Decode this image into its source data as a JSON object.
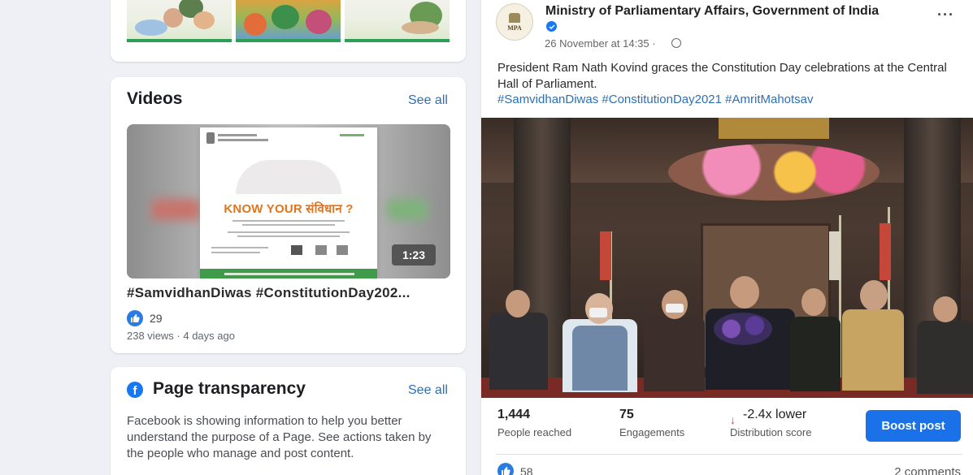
{
  "photos_card": {
    "thumbnails": [
      "photo-1",
      "photo-2",
      "photo-3"
    ]
  },
  "videos": {
    "title": "Videos",
    "see_all": "See all",
    "video": {
      "poster_headline": "KNOW YOUR संविधान ?",
      "duration": "1:23",
      "title": "#SamvidhanDiwas #ConstitutionDay202...",
      "like_count": "29",
      "meta": "238 views · 4 days ago"
    }
  },
  "transparency": {
    "title": "Page transparency",
    "see_all": "See all",
    "text": "Facebook is showing information to help you better understand the purpose of a Page. See actions taken by the people who manage and post content."
  },
  "post": {
    "avatar_text": "MPA",
    "page_name": "Ministry of Parliamentary Affairs, Government of India",
    "time": "26 November at 14:35 ·",
    "more": "···",
    "text": "President Ram Nath Kovind graces the Constitution Day celebrations at the Central Hall of Parliament.",
    "hashtags": "#SamvidhanDiwas #ConstitutionDay2021 #AmritMahotsav",
    "stats": {
      "reached_value": "1,444",
      "reached_label": "People reached",
      "engagements_value": "75",
      "engagements_label": "Engagements",
      "distribution_arrow": "↓",
      "distribution_value": "-2.4x lower",
      "distribution_label": "Distribution score"
    },
    "boost_button": "Boost post",
    "like_count": "58",
    "comments": "2 comments"
  },
  "colors": {
    "accent_blue": "#1b72e8",
    "link_blue": "#2d6fb6",
    "negative_red": "#e53935",
    "background": "#eef0f5"
  },
  "icons": [
    "like-icon",
    "facebook-icon",
    "verified-icon",
    "globe-icon",
    "more-options-icon",
    "down-arrow-icon"
  ]
}
